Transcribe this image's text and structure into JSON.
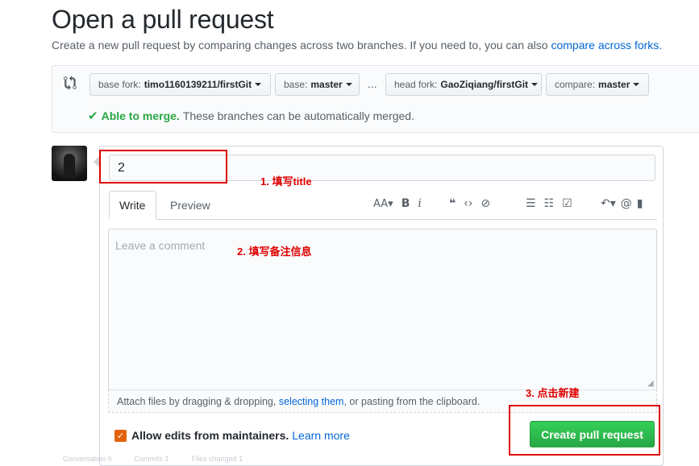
{
  "header": {
    "title": "Open a pull request",
    "subtitle": "Create a new pull request by comparing changes across two branches. If you need to, you can also",
    "subtitle_link": "compare across forks."
  },
  "range": {
    "base_fork_label": "base fork:",
    "base_fork_value": "timo1160139211/firstGit",
    "base_label": "base:",
    "base_value": "master",
    "ellipsis": "...",
    "head_fork_label": "head fork:",
    "head_fork_value": "GaoZiqiang/firstGit",
    "compare_label": "compare:",
    "compare_value": "master",
    "merge_ok": "Able to merge.",
    "merge_text": "These branches can be automatically merged."
  },
  "form": {
    "title_value": "2",
    "tabs": [
      "Write",
      "Preview"
    ],
    "comment_placeholder": "Leave a comment",
    "attach_prefix": "Attach files by dragging & dropping,",
    "attach_link": "selecting them",
    "attach_suffix": ", or pasting from the clipboard.",
    "allow_edits_label": "Allow edits from maintainers.",
    "learn_more": "Learn more",
    "submit_label": "Create pull request"
  },
  "footer_tabs": [
    "Conversation 0",
    "Commits 1",
    "Files changed 1"
  ],
  "annotations": {
    "step1": "1. 填写title",
    "step2": "2. 填写备注信息",
    "step3": "3. 点击新建"
  },
  "colors": {
    "accent_link": "#0366d6",
    "merge_green": "#28a745",
    "annotation_red": "#e00000",
    "checkbox_orange": "#e36209"
  }
}
